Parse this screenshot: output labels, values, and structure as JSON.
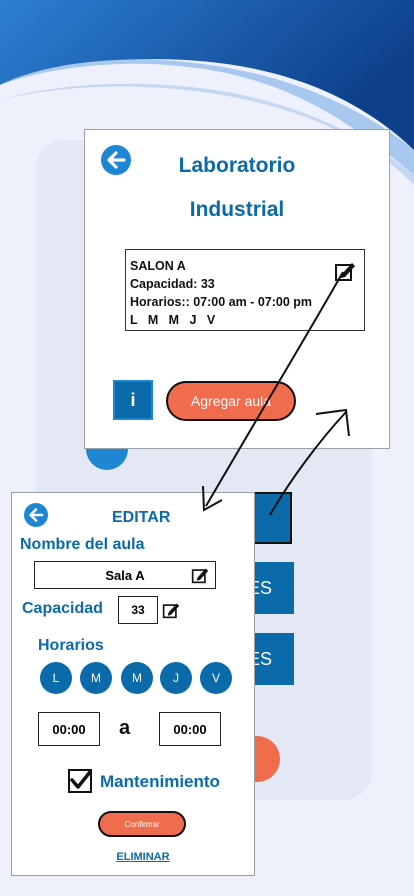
{
  "colors": {
    "primary": "#0b6aa9",
    "accent_blue": "#1e86d3",
    "orange": "#ef6c4c"
  },
  "background": {
    "button1": "ES",
    "button2": "ES"
  },
  "card": {
    "title_line1": "Laboratorio",
    "title_line2": "Industrial",
    "back_icon": "arrow-left-icon",
    "room": {
      "name": "SALON A",
      "capacity": "Capacidad: 33",
      "schedule": "Horarios:: 07:00 am - 07:00 pm",
      "days": "L   M   M   J   V"
    },
    "info_label": "i",
    "add_label": "Agregar aula"
  },
  "edit": {
    "title": "EDITAR",
    "name_label": "Nombre del aula",
    "name_value": "Sala A",
    "capacity_label": "Capacidad",
    "capacity_value": "33",
    "schedule_label": "Horarios",
    "days": [
      "L",
      "M",
      "M",
      "J",
      "V"
    ],
    "time_from": "00:00",
    "time_sep": "a",
    "time_to": "00:00",
    "maintenance_label": "Mantenimiento",
    "maintenance_checked": true,
    "confirm_label": "Confirmar",
    "delete_label": "ELIMINAR"
  }
}
